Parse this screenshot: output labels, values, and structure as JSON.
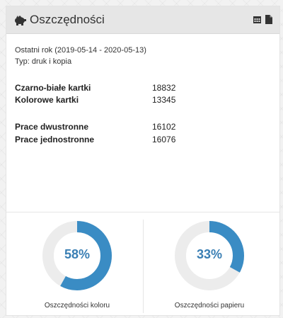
{
  "widget": {
    "title": "Oszczędności",
    "title_icon": "piggy-bank-icon",
    "actions": [
      {
        "icon": "calendar-icon"
      },
      {
        "icon": "file-icon"
      }
    ]
  },
  "summary": {
    "period": "Ostatni rok (2019-05-14 - 2020-05-13)",
    "type": "Typ: druk i kopia"
  },
  "stats": {
    "mono_label": "Czarno-białe kartki",
    "mono_value": "18832",
    "color_label": "Kolorowe kartki",
    "color_value": "13345",
    "duplex_label": "Prace dwustronne",
    "duplex_value": "16102",
    "simplex_label": "Prace jednostronne",
    "simplex_value": "16076"
  },
  "gauges": [
    {
      "percent_text": "58%",
      "fraction": 0.58,
      "caption": "Oszczędności koloru"
    },
    {
      "percent_text": "33%",
      "fraction": 0.33,
      "caption": "Oszczędności papieru"
    }
  ],
  "colors": {
    "accent": "#3a8cc4",
    "track": "#ececec",
    "header_bg": "#e6e6e6"
  }
}
